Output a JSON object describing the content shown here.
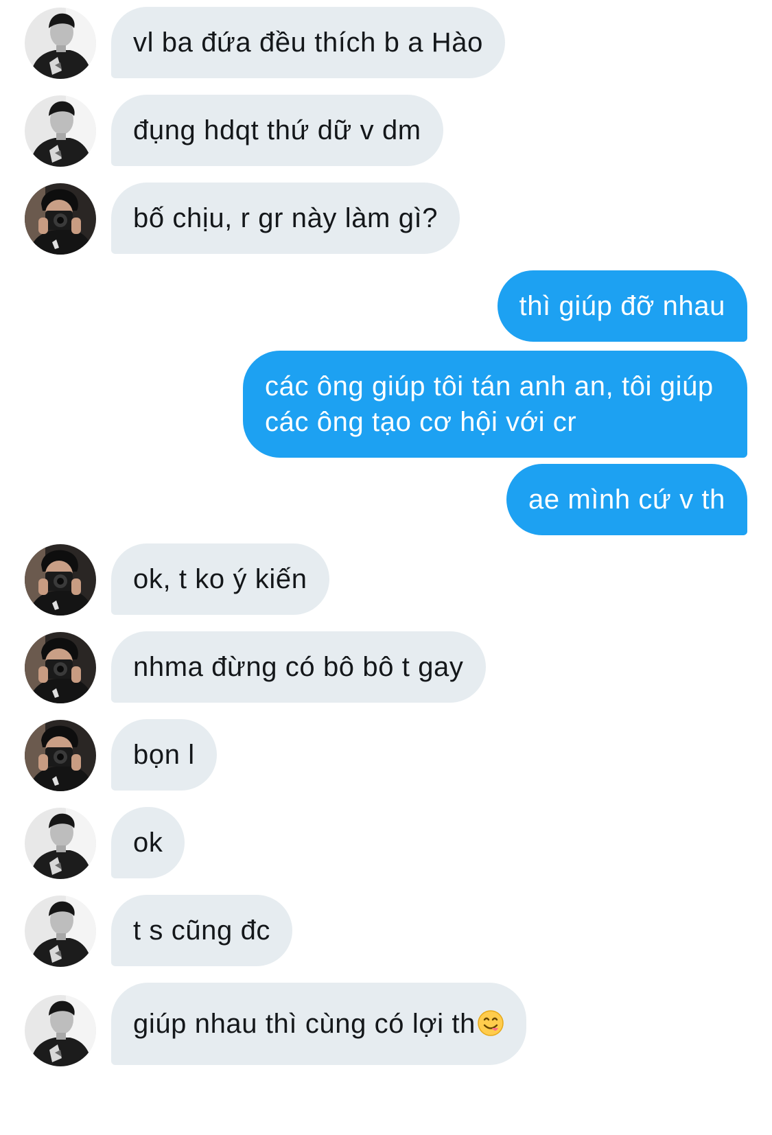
{
  "messages": [
    {
      "sender": "friend-a",
      "text": "vl ba đứa đều thích b a Hào"
    },
    {
      "sender": "friend-a",
      "text": "đụng hdqt thứ dữ v dm"
    },
    {
      "sender": "friend-b",
      "text": "bố chịu, r gr này làm gì?"
    },
    {
      "sender": "me",
      "text": "thì giúp đỡ nhau"
    },
    {
      "sender": "me",
      "text": "các ông giúp tôi tán anh an, tôi giúp các ông tạo cơ hội với cr"
    },
    {
      "sender": "me",
      "text": "ae mình cứ v th"
    },
    {
      "sender": "friend-b",
      "text": "ok, t ko ý kiến"
    },
    {
      "sender": "friend-b",
      "text": "nhma đừng có bô bô t gay"
    },
    {
      "sender": "friend-b",
      "text": "bọn l"
    },
    {
      "sender": "friend-a",
      "text": "ok"
    },
    {
      "sender": "friend-a",
      "text": "t s cũng đc"
    },
    {
      "sender": "friend-a",
      "text": "giúp nhau thì cùng có lợi th",
      "emoji": "yum-face-emoji"
    }
  ],
  "colors": {
    "incoming_bubble": "#e6ecf0",
    "outgoing_bubble": "#1da1f2",
    "incoming_text": "#14171a",
    "outgoing_text": "#ffffff"
  }
}
